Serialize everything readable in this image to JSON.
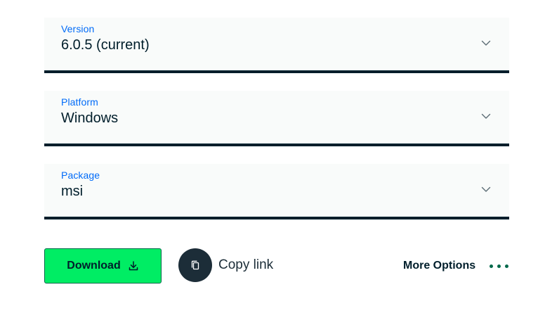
{
  "colors": {
    "accent_label": "#016bf8",
    "text_dark": "#001e2b",
    "download_bg": "#00ed64",
    "download_border": "#00684a",
    "copy_circle": "#1c2d38",
    "dots": "#00684a"
  },
  "selects": [
    {
      "label": "Version",
      "value": "6.0.5 (current)",
      "icon": "chevron-down-icon"
    },
    {
      "label": "Platform",
      "value": "Windows",
      "icon": "chevron-down-icon"
    },
    {
      "label": "Package",
      "value": "msi",
      "icon": "chevron-down-icon"
    }
  ],
  "actions": {
    "download_label": "Download",
    "download_icon": "download-icon",
    "copy_label": "Copy link",
    "copy_icon": "copy-icon",
    "more_label": "More Options",
    "more_icon": "ellipsis-icon"
  }
}
